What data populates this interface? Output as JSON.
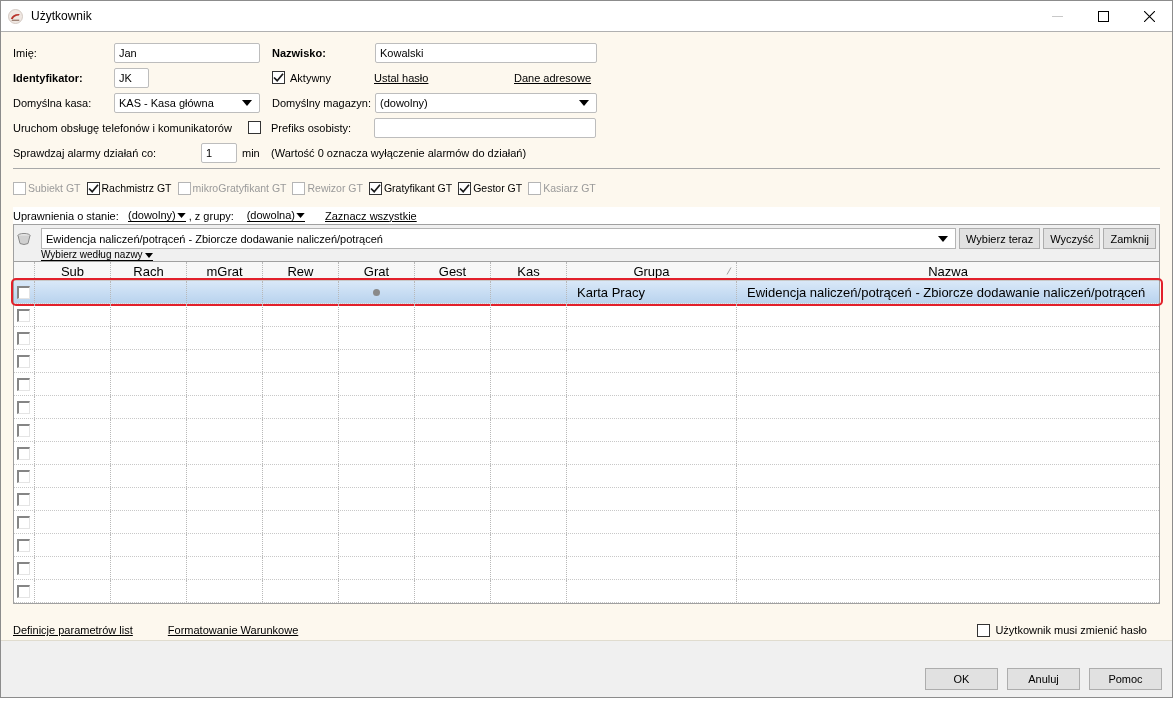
{
  "window": {
    "title": "Użytkownik",
    "minimize_enabled": false
  },
  "form": {
    "first_name": {
      "label": "Imię:",
      "bold": false,
      "value": "Jan"
    },
    "last_name": {
      "label": "Nazwisko:",
      "bold": true,
      "value": "Kowalski"
    },
    "identifier": {
      "label": "Identyfikator:",
      "bold": true,
      "value": "JK"
    },
    "active": {
      "label": "Aktywny",
      "checked": true
    },
    "links": [
      "Ustal hasło",
      "Dane adresowe"
    ],
    "default_cash": {
      "label": "Domyślna kasa:",
      "value": "KAS - Kasa główna"
    },
    "default_warehouse": {
      "label": "Domyślny magazyn:",
      "value": "(dowolny)"
    },
    "phones": {
      "label": "Uruchom obsługę telefonów i komunikatorów",
      "checked": false
    },
    "personal_prefix": {
      "label": "Prefiks osobisty:"
    },
    "alarm": {
      "label": "Sprawdzaj alarmy działań co:",
      "value": "1",
      "unit": "min",
      "note": "(Wartość 0 oznacza wyłączenie alarmów do działań)"
    }
  },
  "modules": [
    {
      "label": "Subiekt GT",
      "checked": false,
      "disabled": true
    },
    {
      "label": "Rachmistrz GT",
      "checked": true,
      "disabled": false
    },
    {
      "label": "mikroGratyfikant GT",
      "checked": false,
      "disabled": true
    },
    {
      "label": "Rewizor GT",
      "checked": false,
      "disabled": true
    },
    {
      "label": "Gratyfikant GT",
      "checked": true,
      "disabled": false
    },
    {
      "label": "Gestor GT",
      "checked": true,
      "disabled": false
    },
    {
      "label": "Kasiarz GT",
      "checked": false,
      "disabled": true
    }
  ],
  "filter": {
    "state_label": "Uprawnienia o stanie:",
    "state_value": "(dowolny)",
    "group_label": ", z grupy:",
    "group_value": "(dowolna)",
    "select_all": "Zaznacz wszystkie"
  },
  "picker": {
    "value": "Ewidencja naliczeń/potrąceń - Zbiorcze dodawanie naliczeń/potrąceń",
    "buttons": [
      "Wybierz teraz",
      "Wyczyść",
      "Zamknij"
    ],
    "mode": "Wybierz według nazwy"
  },
  "table": {
    "columns": [
      {
        "label": "Sub",
        "kind": "flag",
        "sorted": false
      },
      {
        "label": "Rach",
        "kind": "flag",
        "sorted": false
      },
      {
        "label": "mGrat",
        "kind": "flag",
        "sorted": false
      },
      {
        "label": "Rew",
        "kind": "flag",
        "sorted": false
      },
      {
        "label": "Grat",
        "kind": "flag",
        "sorted": false
      },
      {
        "label": "Gest",
        "kind": "flag",
        "sorted": false
      },
      {
        "label": "Kas",
        "kind": "flag",
        "sorted": false
      },
      {
        "label": "Grupa",
        "kind": "text",
        "sorted": true
      },
      {
        "label": "Nazwa",
        "kind": "text",
        "sorted": false
      }
    ],
    "rows": [
      {
        "selected": true,
        "outlined": true,
        "checked": false,
        "flags": [
          false,
          false,
          false,
          false,
          true,
          false,
          false
        ],
        "texts": [
          "Karta Pracy",
          "Ewidencja naliczeń/potrąceń - Zbiorcze dodawanie naliczeń/potrąceń"
        ]
      },
      {
        "selected": false,
        "outlined": false,
        "checked": false
      },
      {
        "selected": false,
        "outlined": false,
        "checked": false
      },
      {
        "selected": false,
        "outlined": false,
        "checked": false
      },
      {
        "selected": false,
        "outlined": false,
        "checked": false
      },
      {
        "selected": false,
        "outlined": false,
        "checked": false
      },
      {
        "selected": false,
        "outlined": false,
        "checked": false
      },
      {
        "selected": false,
        "outlined": false,
        "checked": false
      },
      {
        "selected": false,
        "outlined": false,
        "checked": false
      },
      {
        "selected": false,
        "outlined": false,
        "checked": false
      },
      {
        "selected": false,
        "outlined": false,
        "checked": false
      },
      {
        "selected": false,
        "outlined": false,
        "checked": false
      },
      {
        "selected": false,
        "outlined": false,
        "checked": false
      },
      {
        "selected": false,
        "outlined": false,
        "checked": false
      }
    ]
  },
  "footer": {
    "links": [
      "Definicje parametrów list",
      "Formatowanie Warunkowe"
    ],
    "must_change_password": {
      "label": "Użytkownik musi zmienić hasło",
      "checked": false
    }
  },
  "buttons": [
    "OK",
    "Anuluj",
    "Pomoc"
  ]
}
